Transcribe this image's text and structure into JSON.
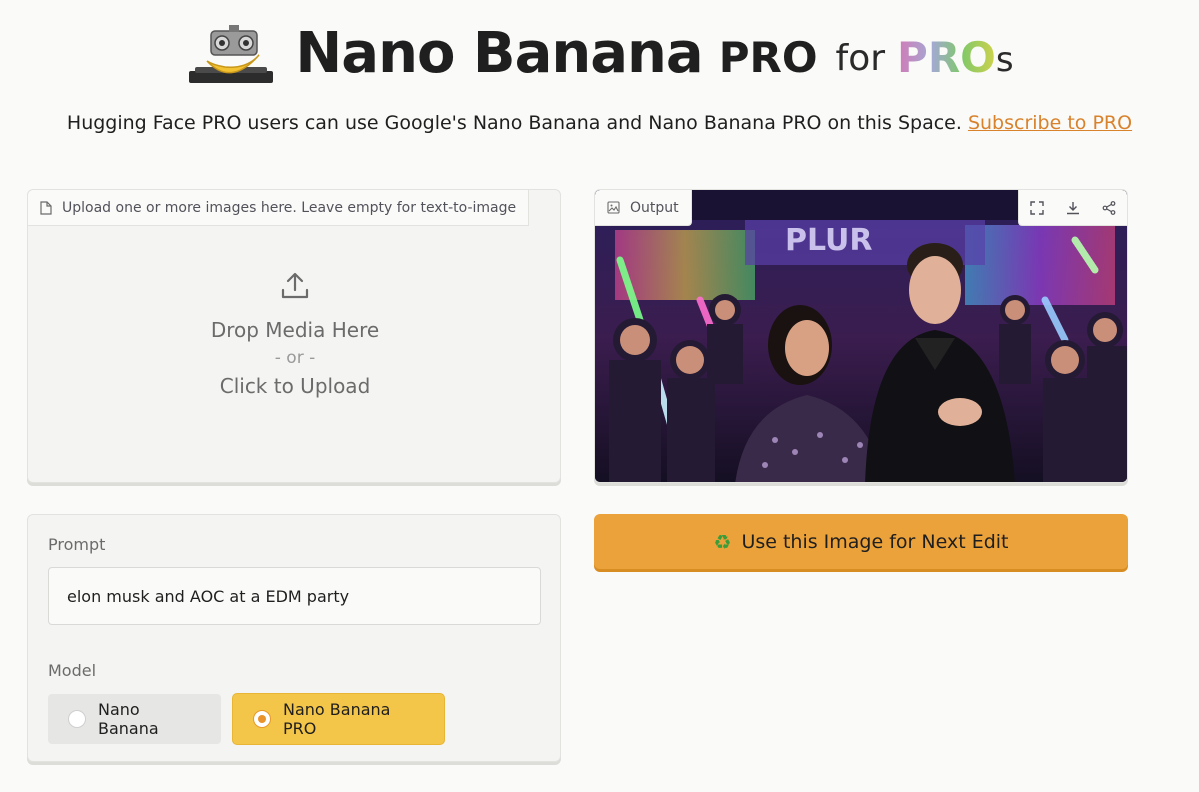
{
  "header": {
    "title_main": "Nano Banana",
    "title_pro": "PRO",
    "title_for": "for",
    "title_pros": "PRO",
    "title_s": "s"
  },
  "subtitle": {
    "text": "Hugging Face PRO users can use Google's Nano Banana and Nano Banana PRO on this Space. ",
    "link_text": "Subscribe to PRO",
    "link_color": "#d8822c"
  },
  "upload": {
    "label": "Upload one or more images here. Leave empty for text-to-image",
    "label_icon": "file-icon",
    "drop_text": "Drop Media Here",
    "or_text": "- or -",
    "click_text": "Click to Upload",
    "upload_icon": "upload-icon"
  },
  "output": {
    "label": "Output",
    "label_icon": "image-icon",
    "tools": [
      "fullscreen-icon",
      "download-icon",
      "share-icon"
    ],
    "sign_text": "PLUR"
  },
  "next_edit": {
    "icon": "recycle-icon",
    "label": "Use this Image for Next Edit",
    "color": "#eba23b"
  },
  "prompt": {
    "label": "Prompt",
    "value": "elon musk and AOC at a EDM party"
  },
  "model": {
    "label": "Model",
    "options": [
      {
        "label": "Nano Banana",
        "selected": false
      },
      {
        "label": "Nano Banana PRO",
        "selected": true
      }
    ],
    "accent": "#f3c548"
  }
}
